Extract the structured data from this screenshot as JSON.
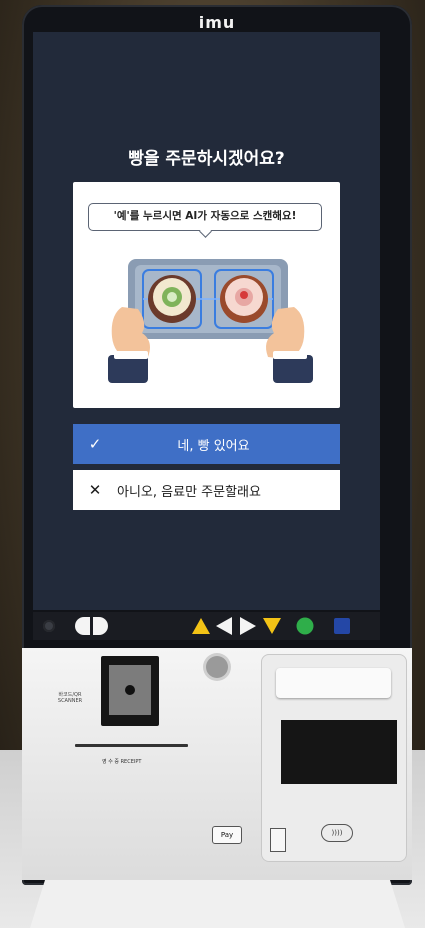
{
  "brand": "imu",
  "screen": {
    "question": "빵을 주문하시겠어요?",
    "bubble_text": "'예'를 누르시면  AI가 자동으로 스캔해요!",
    "yes_button": {
      "mark": "✓",
      "label": "네, 빵 있어요"
    },
    "no_button": {
      "mark": "✕",
      "label": "아니오, 음료만 주문할래요"
    }
  },
  "hardware": {
    "barcode_label": "바코드/QR SCANNER",
    "receipt_label": "영 수 증 RECEIPT",
    "applepay_label": "Pay",
    "nfc_symbol": "))))"
  },
  "colors": {
    "screen_bg": "#222a3a",
    "yes_button": "#3f6fc6",
    "triangle_yellow": "#f3c316",
    "green": "#2fae4a",
    "blue": "#2447a6"
  },
  "icons": [
    "camera-icon",
    "half-circle-icon",
    "arrow-up-icon",
    "arrow-left-icon",
    "arrow-right-icon",
    "arrow-down-icon",
    "green-circle-icon",
    "blue-square-icon"
  ]
}
